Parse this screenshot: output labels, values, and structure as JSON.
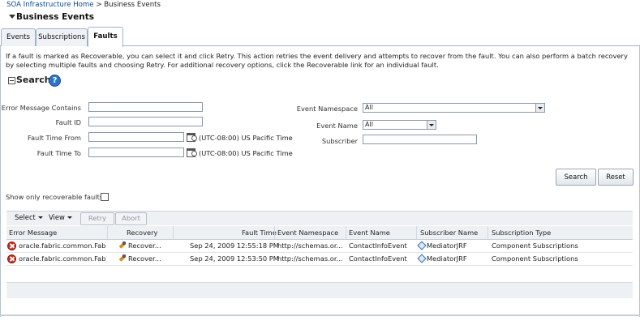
{
  "breadcrumb": {
    "home": "SOA Infrastructure Home",
    "separator": ">",
    "current": "Business Events"
  },
  "page_title": "Business Events",
  "tabs": [
    {
      "label": "Events"
    },
    {
      "label": "Subscriptions"
    },
    {
      "label": "Faults",
      "active": true
    }
  ],
  "description": "If a fault is marked as Recoverable, you can select it and click Retry. This action retries the event delivery and attempts to recover from the fault. You can also perform a batch recovery by selecting multiple faults and choosing Retry. For additional recovery options, click the Recoverable link for an individual fault.",
  "search": {
    "title": "Search",
    "fields": {
      "error_message_label": "Error Message Contains",
      "error_message_value": "",
      "fault_id_label": "Fault ID",
      "fault_id_value": "",
      "time_from_label": "Fault Time From",
      "time_from_value": "",
      "time_to_label": "Fault Time To",
      "time_to_value": "",
      "timezone": "(UTC-08:00) US Pacific Time",
      "event_namespace_label": "Event Namespace",
      "event_namespace_value": "All",
      "event_name_label": "Event Name",
      "event_name_value": "All",
      "subscriber_label": "Subscriber",
      "subscriber_value": ""
    },
    "search_button": "Search",
    "reset_button": "Reset"
  },
  "recoverable_filter_label": "Show only recoverable faults",
  "toolbar": {
    "select_menu": "Select",
    "view_menu": "View",
    "retry": "Retry",
    "abort": "Abort"
  },
  "table": {
    "headers": [
      "Error Message",
      "Recovery",
      "Fault Time",
      "Event Namespace",
      "Event Name",
      "Subscriber Name",
      "Subscription Type"
    ],
    "rows": [
      {
        "error_message": "oracle.fabric.common.Fabri",
        "recovery": "Recover...",
        "fault_time": "Sep 24, 2009 12:55:18 PM",
        "event_namespace": "http://schemas.or...",
        "event_name": "ContactInfoEvent",
        "subscriber_name": "MediatorJRF",
        "subscription_type": "Component Subscriptions"
      },
      {
        "error_message": "oracle.fabric.common.Fabri",
        "recovery": "Recover...",
        "fault_time": "Sep 24, 2009 12:53:50 PM",
        "event_namespace": "http://schemas.or...",
        "event_name": "ContactInfoEvent",
        "subscriber_name": "MediatorJRF",
        "subscription_type": "Component Subscriptions"
      }
    ]
  },
  "colors": {
    "link": "#0b4a8f",
    "error_icon": "#cc2b1d",
    "help_icon": "#2a75c9",
    "tab_border": "#9fb3c8"
  }
}
